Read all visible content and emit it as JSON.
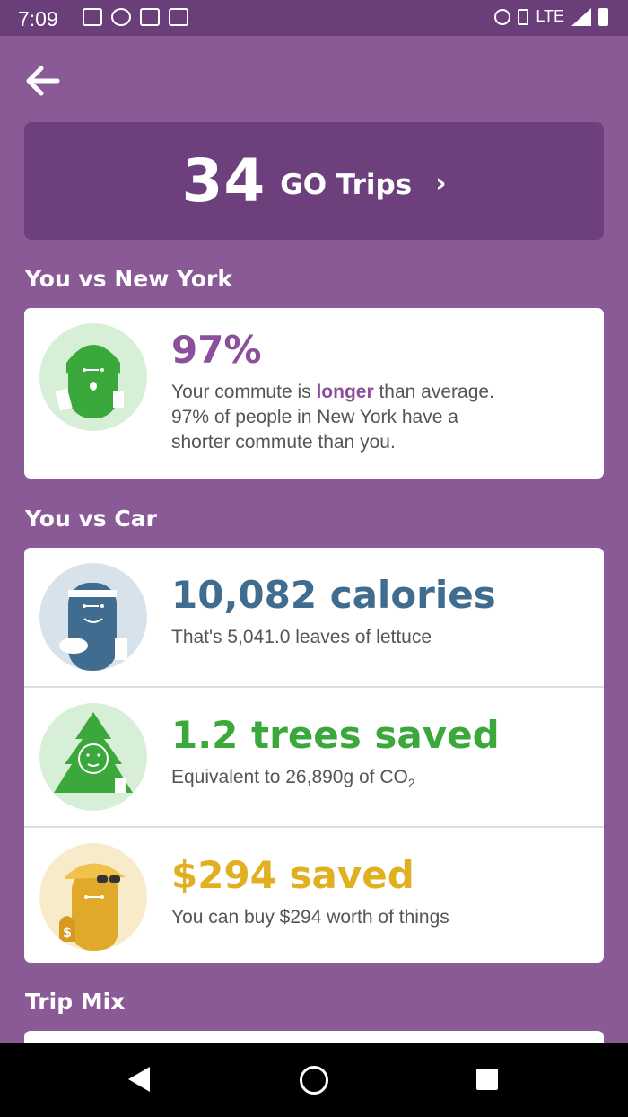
{
  "status_bar": {
    "time": "7:09",
    "network": "LTE"
  },
  "hero": {
    "count": "34",
    "label": "GO Trips",
    "chevron": "›"
  },
  "sections": {
    "you_vs_city": "You vs New York",
    "you_vs_car": "You vs Car",
    "trip_mix": "Trip Mix"
  },
  "commute": {
    "percent": "97%",
    "line1_pre": "Your commute is ",
    "line1_highlight": "longer",
    "line1_post": " than average.",
    "line2": "97% of people in New York have a",
    "line3": "shorter commute than you."
  },
  "calories": {
    "metric": "10,082 calories",
    "desc": "That's 5,041.0 leaves of lettuce"
  },
  "trees": {
    "metric": "1.2 trees saved",
    "desc_pre": "Equivalent to 26,890g of CO",
    "desc_sub": "2"
  },
  "money": {
    "metric": "$294 saved",
    "desc": "You can buy $294 worth of things"
  },
  "colors": {
    "purple_bg": "#8a5a96",
    "purple_dark": "#6d3f7d",
    "accent_purple": "#8b4f9b",
    "blue": "#3f6c8f",
    "green": "#3aa83a",
    "gold": "#e0b020"
  },
  "icons": {
    "back": "arrow-left-icon",
    "commute_avatar": "commuter-avatar-icon",
    "calories_avatar": "athlete-avatar-icon",
    "trees_avatar": "tree-avatar-icon",
    "money_avatar": "money-avatar-icon"
  }
}
